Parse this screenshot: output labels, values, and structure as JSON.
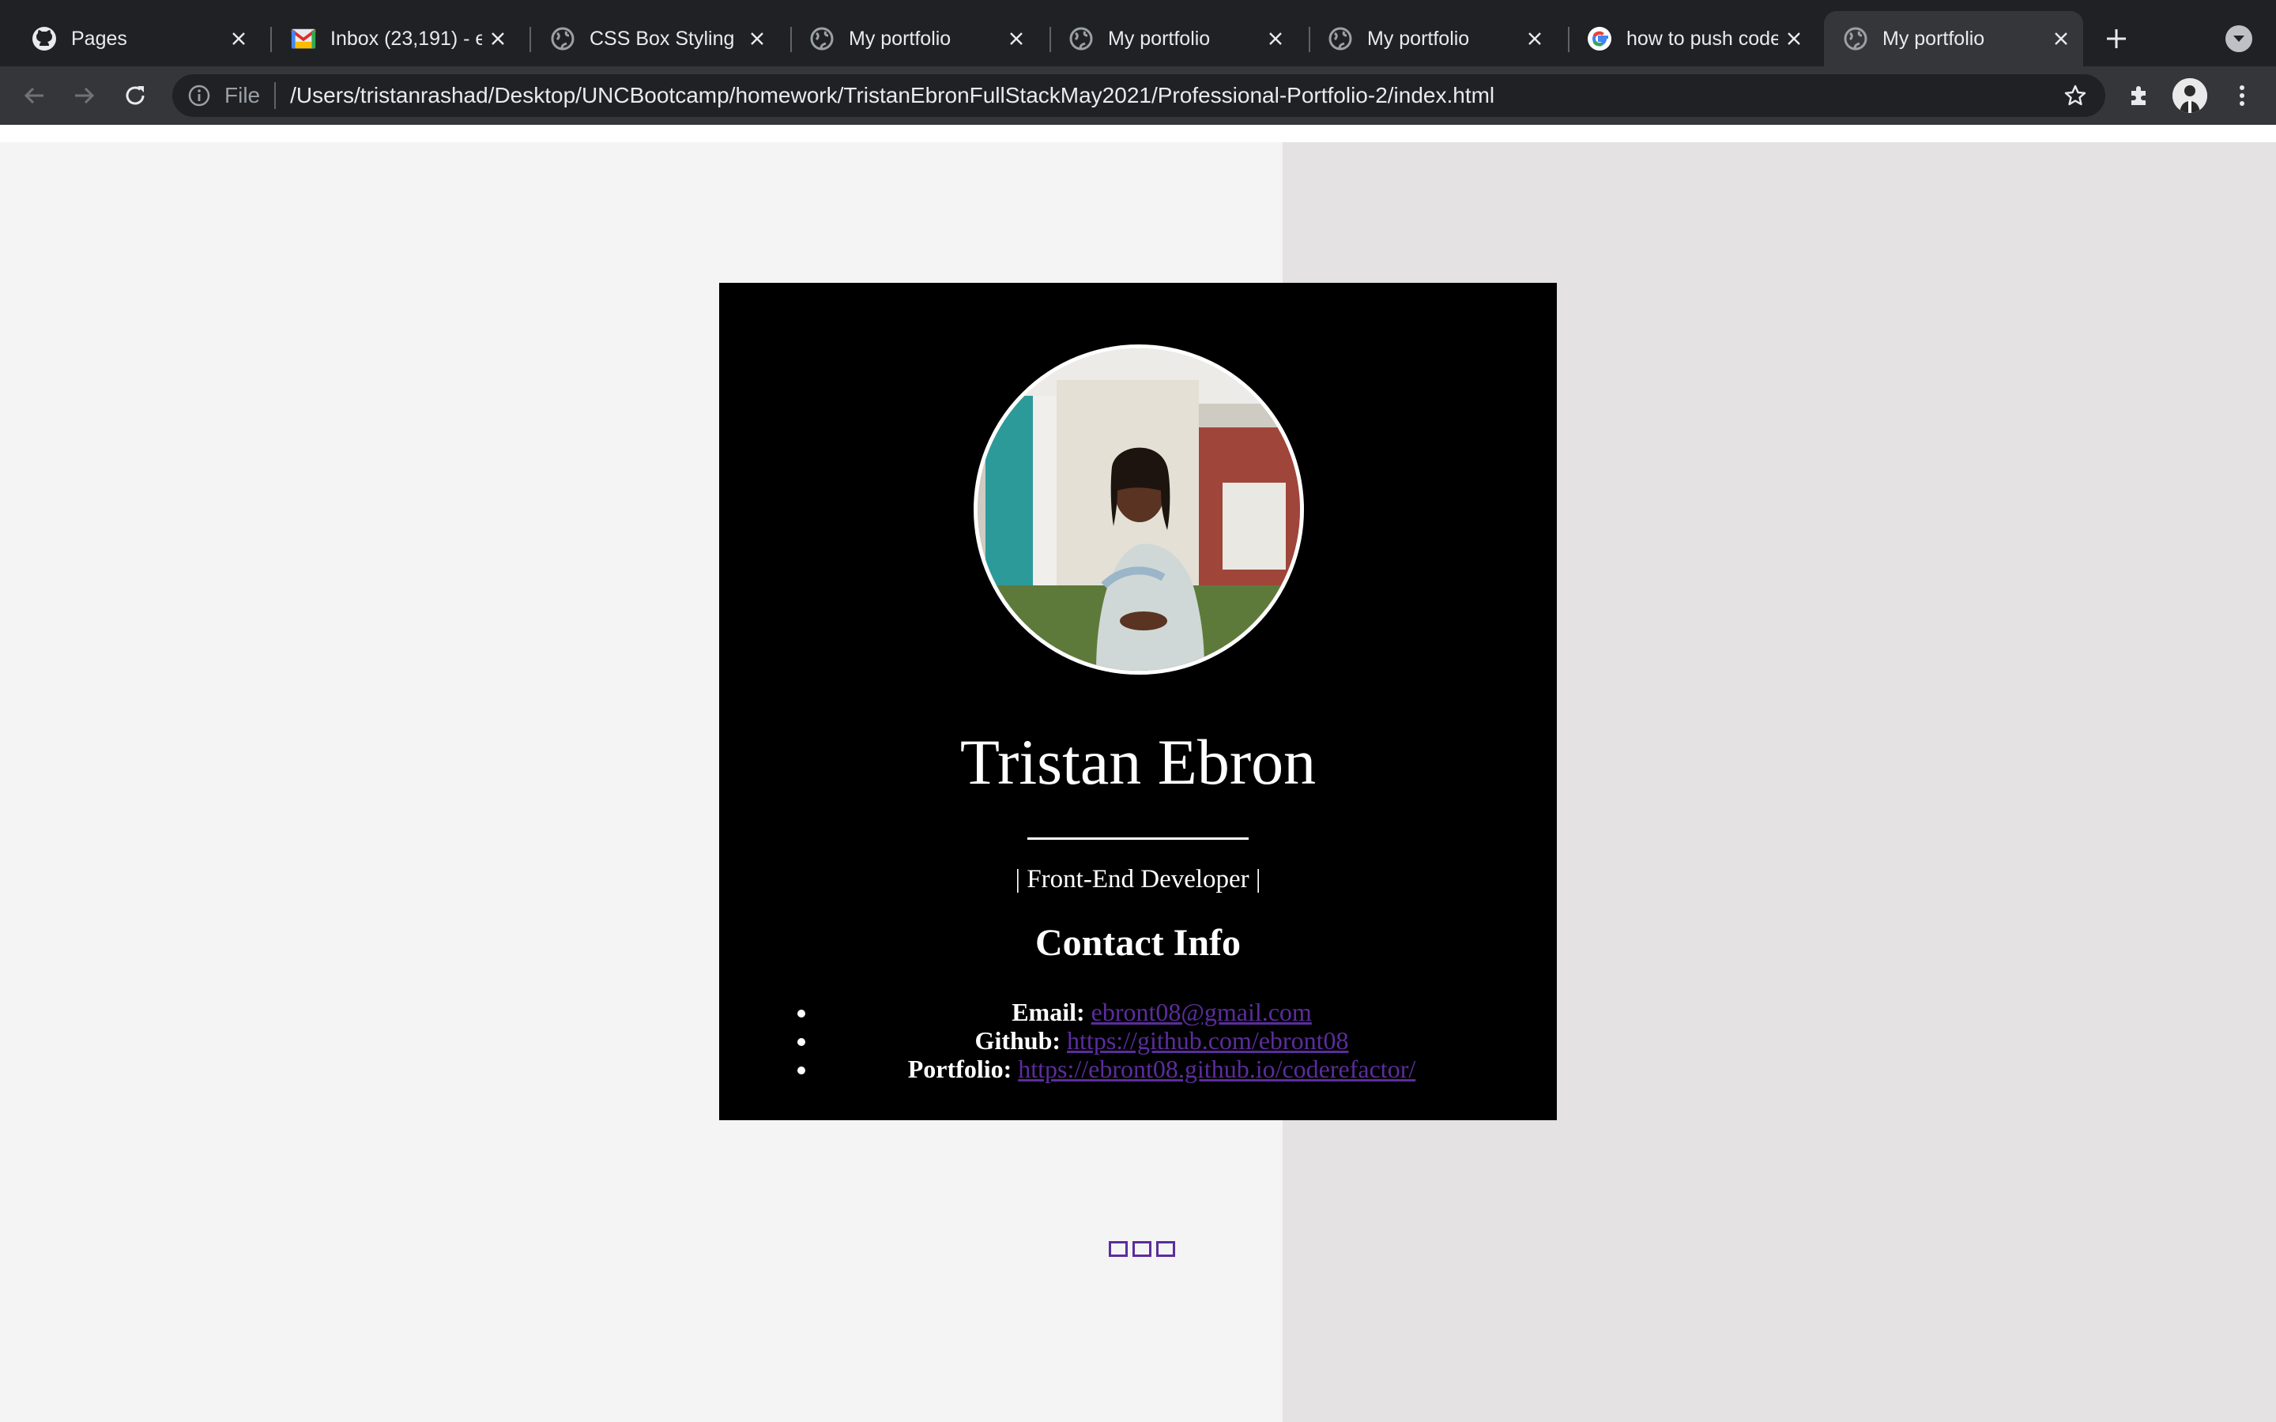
{
  "browser": {
    "tabs": [
      {
        "title": "Pages",
        "icon": "github-icon",
        "active": false
      },
      {
        "title": "Inbox (23,191) - e",
        "icon": "gmail-icon",
        "active": false
      },
      {
        "title": "CSS Box Styling",
        "icon": "globe-icon",
        "active": false
      },
      {
        "title": "My portfolio",
        "icon": "globe-icon",
        "active": false
      },
      {
        "title": "My portfolio",
        "icon": "globe-icon",
        "active": false
      },
      {
        "title": "My portfolio",
        "icon": "globe-icon",
        "active": false
      },
      {
        "title": "how to push code",
        "icon": "google-icon",
        "active": false
      },
      {
        "title": "My portfolio",
        "icon": "globe-icon",
        "active": true
      }
    ],
    "address": {
      "scheme": "File",
      "url": "/Users/tristanrashad/Desktop/UNCBootcamp/homework/TristanEbronFullStackMay2021/Professional-Portfolio-2/index.html"
    }
  },
  "profile": {
    "name": "Tristan Ebron",
    "role": "| Front-End Developer |",
    "contact_heading": "Contact Info",
    "contacts": [
      {
        "label": "Email:",
        "value": "ebront08@gmail.com"
      },
      {
        "label": "Github:",
        "value": "https://github.com/ebront08"
      },
      {
        "label": "Portfolio:",
        "value": "https://ebront08.github.io/coderefactor/"
      }
    ]
  },
  "colors": {
    "chrome_dark": "#202124",
    "toolbar": "#35363a",
    "card_bg": "#000000",
    "link": "#5b2d9c",
    "page_left": "#f4f4f4",
    "page_right": "#e4e2e2"
  }
}
